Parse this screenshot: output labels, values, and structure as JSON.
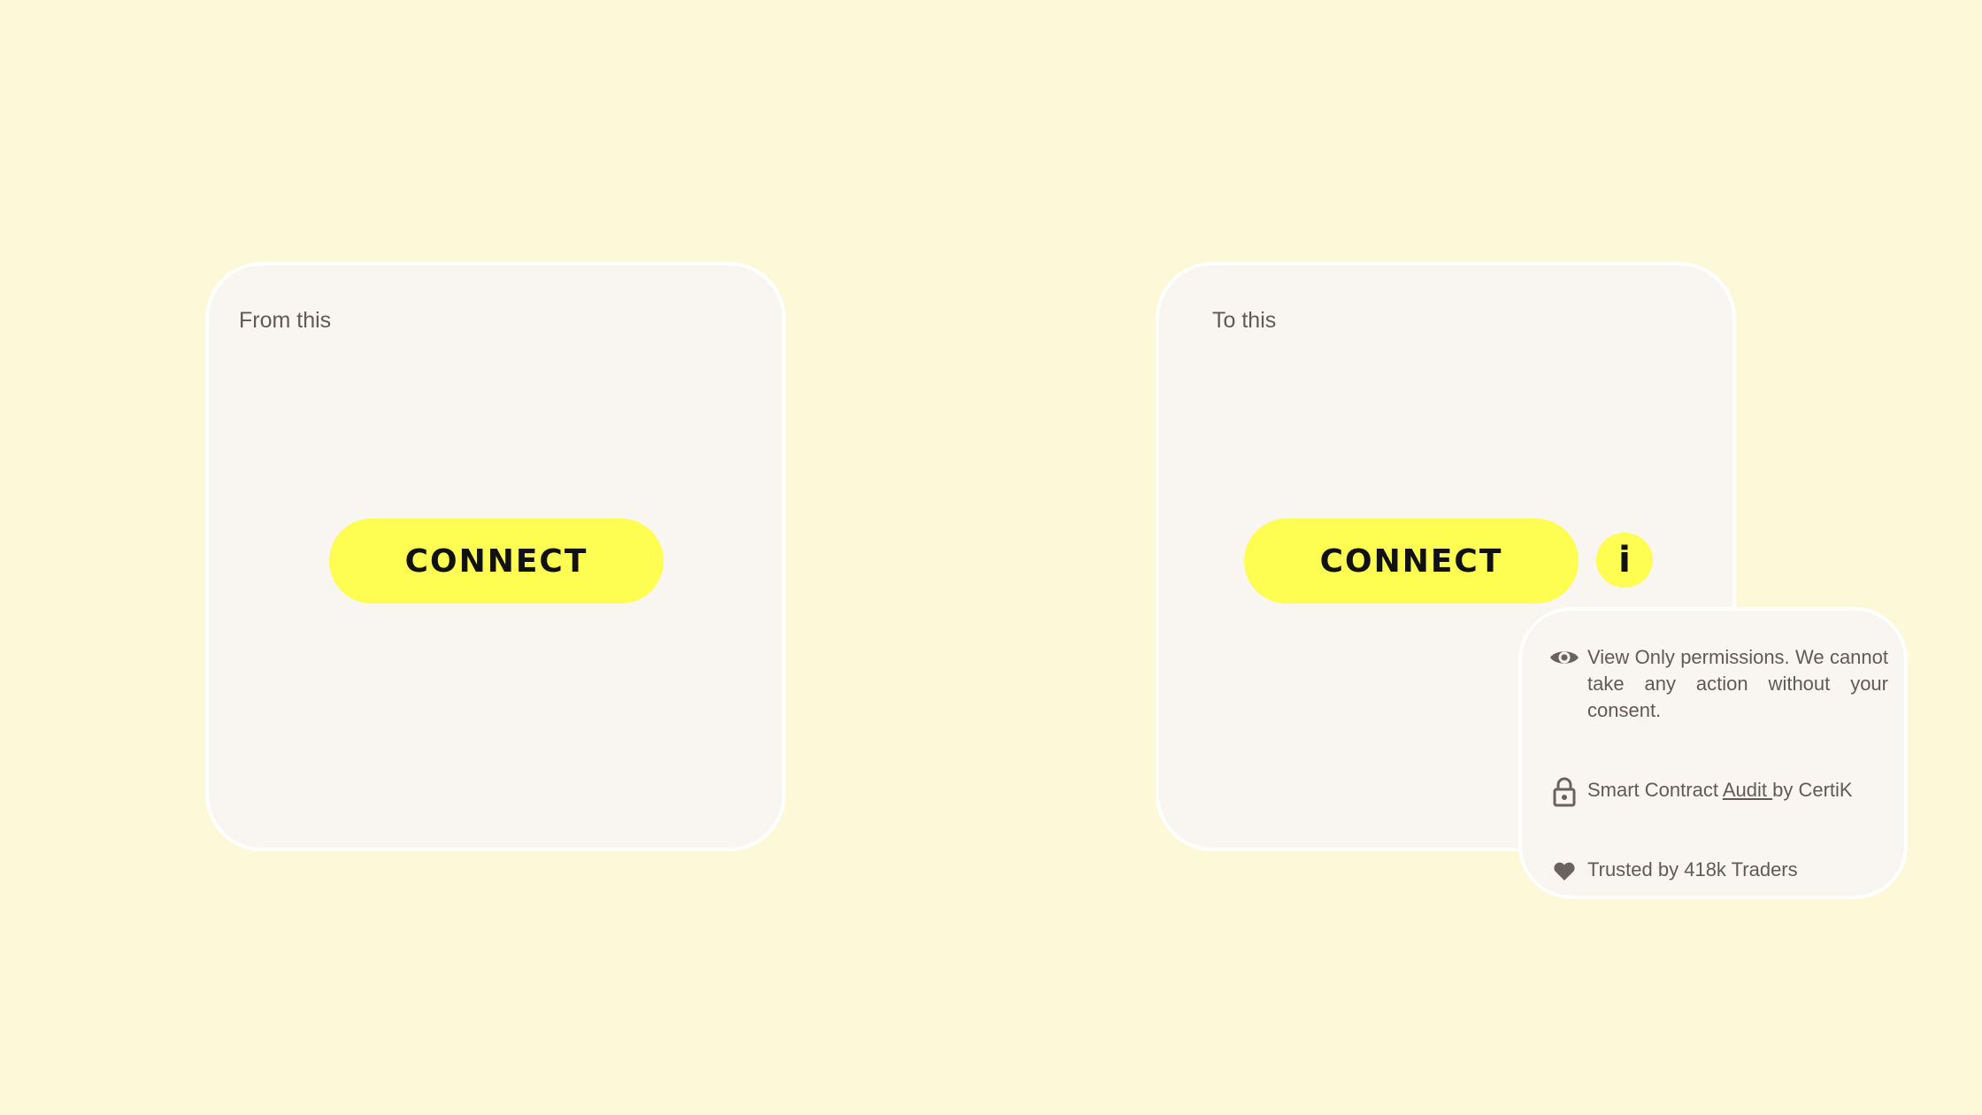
{
  "before_card": {
    "label": "From this",
    "connect_label": "CONNECT"
  },
  "after_card": {
    "label": "To this",
    "connect_label": "CONNECT",
    "info_label": "i"
  },
  "info_popover": {
    "permissions_text": "View Only permissions. We cannot take any action without your consent.",
    "audit_prefix": "Smart Contract ",
    "audit_link": "Audit ",
    "audit_suffix": "by CertiK",
    "trust_text": "Trusted by 418k Traders",
    "icons": [
      "eye-icon",
      "lock-icon",
      "heart-icon"
    ]
  },
  "colors": {
    "background": "#fcf8d8",
    "card": "#f9f6f1",
    "button": "#fdfd52",
    "text": "#5f5a55"
  }
}
